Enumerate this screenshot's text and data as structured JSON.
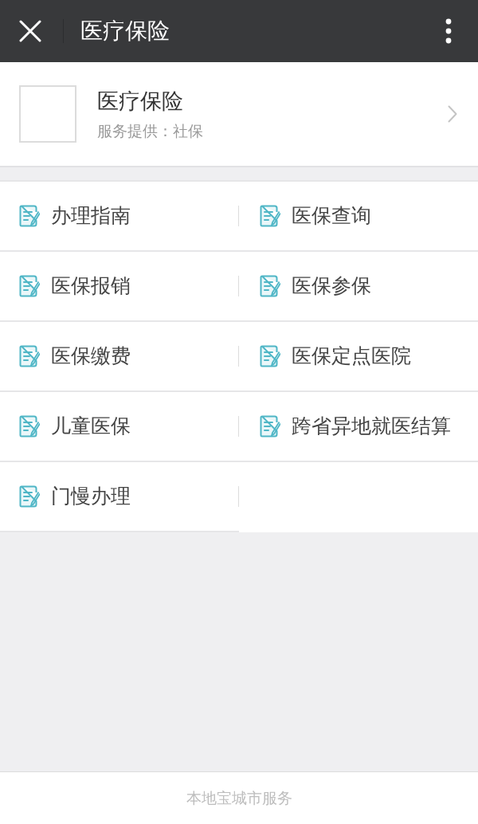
{
  "top_bar": {
    "title": "医疗保险"
  },
  "service": {
    "title": "医疗保险",
    "provider": "服务提供：社保"
  },
  "menu": {
    "items": [
      {
        "label": "办理指南"
      },
      {
        "label": "医保查询"
      },
      {
        "label": "医保报销"
      },
      {
        "label": "医保参保"
      },
      {
        "label": "医保缴费"
      },
      {
        "label": "医保定点医院"
      },
      {
        "label": "儿童医保"
      },
      {
        "label": "跨省异地就医结算"
      },
      {
        "label": "门慢办理"
      }
    ]
  },
  "footer": {
    "text": "本地宝城市服务"
  }
}
